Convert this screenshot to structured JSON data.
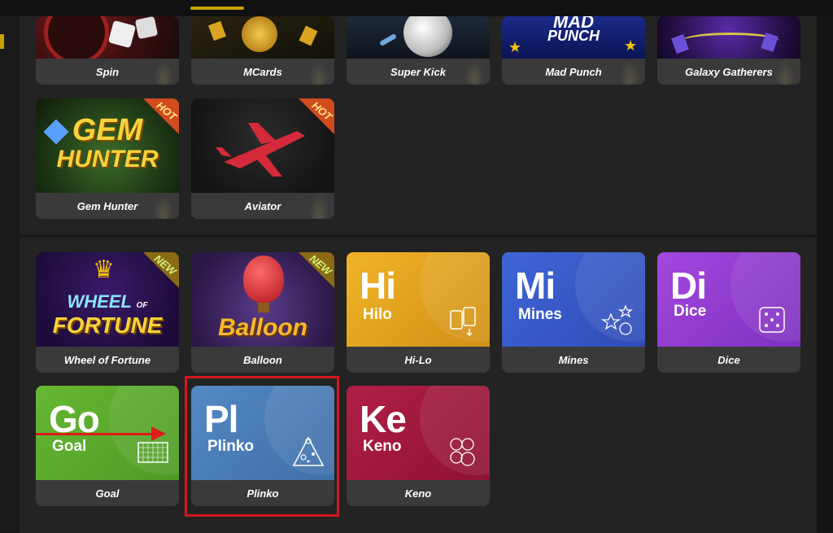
{
  "colors": {
    "background": "#171717",
    "section_bg": "#232323",
    "card_label_bg": "#3a3a3a",
    "accent_gold": "#c8a200",
    "highlight_red": "#d4181f",
    "hilo": "#e0a21e",
    "mines": "#3b5fcf",
    "dice": "#8f3fd0",
    "goal": "#5aa62a",
    "plinko": "#4d7fb8",
    "keno": "#a3183c"
  },
  "section1": {
    "row1": [
      {
        "label": "Spin",
        "icon": "roulette-dice-icon"
      },
      {
        "label": "MCards",
        "icon": "cards-coins-icon"
      },
      {
        "label": "Super Kick",
        "icon": "soccer-ball-icon"
      },
      {
        "label": "Mad Punch",
        "icon": "mad-punch-logo",
        "art_text1": "MAD",
        "art_text2": "PUNCH"
      },
      {
        "label": "Galaxy Gatherers",
        "icon": "galaxy-cards-icon"
      }
    ],
    "row2": [
      {
        "label": "Gem Hunter",
        "badge": "HOT",
        "art_text1": "GEM",
        "art_text2": "HUNTER"
      },
      {
        "label": "Aviator",
        "badge": "HOT",
        "icon": "airplane-icon"
      }
    ]
  },
  "section2": {
    "row1": [
      {
        "label": "Wheel of Fortune",
        "badge": "NEW",
        "art_text1": "WHEEL",
        "art_text_of": "OF",
        "art_text2": "FORTUNE"
      },
      {
        "label": "Balloon",
        "badge": "NEW",
        "art_text1": "Balloon"
      },
      {
        "label": "Hi-Lo",
        "big": "Hi",
        "sub": "Hilo",
        "icon": "hilo-cards-icon"
      },
      {
        "label": "Mines",
        "big": "Mi",
        "sub": "Mines",
        "icon": "mines-stars-icon"
      },
      {
        "label": "Dice",
        "big": "Di",
        "sub": "Dice",
        "icon": "dice-icon"
      }
    ],
    "row2": [
      {
        "label": "Goal",
        "big": "Go",
        "sub": "Goal",
        "icon": "goal-net-icon"
      },
      {
        "label": "Plinko",
        "big": "Pl",
        "sub": "Plinko",
        "icon": "plinko-pyramid-icon"
      },
      {
        "label": "Keno",
        "big": "Ke",
        "sub": "Keno",
        "icon": "keno-balls-icon"
      }
    ]
  }
}
